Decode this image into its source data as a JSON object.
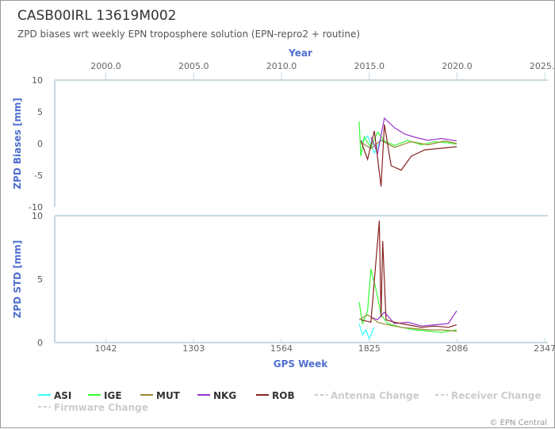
{
  "page": {
    "title": "CASB00IRL 13619M002",
    "subtitle": "ZPD biases wrt weekly EPN troposphere solution (EPN-repro2 + routine)",
    "credit": "© EPN Central"
  },
  "colors": {
    "ASI": "#33ffff",
    "IGE": "#33ff33",
    "MUT": "#998833",
    "NKG": "#9933cc",
    "ROB": "#882222",
    "axis_title": "#4f6fd0",
    "axis_line": "#c8d8e0",
    "muted": "#cccccc"
  },
  "chart_data": {
    "type": "line",
    "x_top": {
      "label": "Year",
      "ticks": [
        "2000.0",
        "2005.0",
        "2010.0",
        "2015.0",
        "2020.0",
        "2025.0"
      ],
      "tick_values": [
        1042,
        1303,
        1564,
        1825,
        2086,
        2347
      ]
    },
    "x_bottom": {
      "label": "GPS Week",
      "ticks": [
        "1042",
        "1303",
        "1564",
        "1825",
        "2086",
        "2347"
      ],
      "range": [
        890,
        2356
      ]
    },
    "panels": [
      {
        "id": "bias",
        "ylabel": "ZPD Biases [mm]",
        "ylim": [
          -10,
          10
        ],
        "yticks": [
          "-10",
          "-5",
          "0",
          "5",
          "10"
        ],
        "ytick_values": [
          -10,
          -5,
          0,
          5,
          10
        ],
        "series": [
          {
            "name": "ASI",
            "x": [
              1800,
              1820,
              1840,
              1860,
              1880
            ],
            "y": [
              0.2,
              1.2,
              -1.5,
              0.6,
              0.1
            ]
          },
          {
            "name": "IGE",
            "x": [
              1795,
              1800,
              1810,
              1830,
              1850,
              1870,
              1900,
              1940,
              1980,
              2020,
              2060,
              2085
            ],
            "y": [
              3.5,
              -2.0,
              1.0,
              -0.6,
              1.8,
              0.4,
              -0.3,
              0.5,
              -0.2,
              0.3,
              0.1,
              -0.1
            ]
          },
          {
            "name": "MUT",
            "x": [
              1800,
              1830,
              1860,
              1900,
              1950,
              2000,
              2050,
              2085
            ],
            "y": [
              0.2,
              -0.8,
              0.5,
              -0.6,
              0.3,
              -0.2,
              0.4,
              0.0
            ]
          },
          {
            "name": "NKG",
            "x": [
              1830,
              1850,
              1870,
              1900,
              1930,
              1960,
              2000,
              2040,
              2085
            ],
            "y": [
              1.0,
              -1.5,
              4.0,
              2.5,
              1.5,
              1.0,
              0.5,
              0.8,
              0.4
            ]
          },
          {
            "name": "ROB",
            "x": [
              1800,
              1820,
              1840,
              1860,
              1870,
              1890,
              1920,
              1950,
              1990,
              2030,
              2085
            ],
            "y": [
              0.5,
              -2.5,
              2.0,
              -6.8,
              3.0,
              -3.5,
              -4.2,
              -2.0,
              -1.0,
              -0.8,
              -0.5
            ]
          }
        ]
      },
      {
        "id": "std",
        "ylabel": "ZPD STD [mm]",
        "ylim": [
          0,
          10
        ],
        "yticks": [
          "0",
          "5",
          "10"
        ],
        "ytick_values": [
          0,
          5,
          10
        ],
        "series": [
          {
            "name": "ASI",
            "x": [
              1795,
              1805,
              1815,
              1825,
              1840
            ],
            "y": [
              1.5,
              0.6,
              1.0,
              0.3,
              1.2
            ]
          },
          {
            "name": "IGE",
            "x": [
              1795,
              1805,
              1820,
              1830,
              1845,
              1860,
              1880,
              1920,
              1960,
              2000,
              2040,
              2085
            ],
            "y": [
              3.2,
              1.5,
              2.5,
              5.8,
              4.2,
              2.2,
              1.5,
              1.2,
              1.0,
              0.9,
              0.8,
              1.0
            ]
          },
          {
            "name": "MUT",
            "x": [
              1795,
              1820,
              1850,
              1880,
              1920,
              1960,
              2000,
              2040,
              2085
            ],
            "y": [
              1.8,
              2.2,
              1.6,
              1.4,
              1.2,
              1.1,
              1.0,
              1.0,
              0.9
            ]
          },
          {
            "name": "NKG",
            "x": [
              1830,
              1850,
              1870,
              1900,
              1940,
              1980,
              2020,
              2060,
              2085
            ],
            "y": [
              2.0,
              1.8,
              2.4,
              1.5,
              1.6,
              1.3,
              1.4,
              1.5,
              2.5
            ]
          },
          {
            "name": "ROB",
            "x": [
              1800,
              1830,
              1855,
              1860,
              1865,
              1875,
              1900,
              1940,
              1980,
              2020,
              2060,
              2085
            ],
            "y": [
              1.8,
              1.6,
              9.6,
              2.0,
              8.0,
              1.8,
              1.6,
              1.4,
              1.2,
              1.3,
              1.2,
              1.4
            ]
          }
        ]
      }
    ]
  },
  "legend": {
    "items": [
      {
        "label": "ASI",
        "color": "#33ffff",
        "muted": false
      },
      {
        "label": "IGE",
        "color": "#33ff33",
        "muted": false
      },
      {
        "label": "MUT",
        "color": "#998833",
        "muted": false
      },
      {
        "label": "NKG",
        "color": "#9933cc",
        "muted": false
      },
      {
        "label": "ROB",
        "color": "#882222",
        "muted": false
      },
      {
        "label": "Antenna Change",
        "color": "#cccccc",
        "muted": true
      },
      {
        "label": "Receiver Change",
        "color": "#cccccc",
        "muted": true
      },
      {
        "label": "Firmware Change",
        "color": "#cccccc",
        "muted": true
      }
    ]
  }
}
